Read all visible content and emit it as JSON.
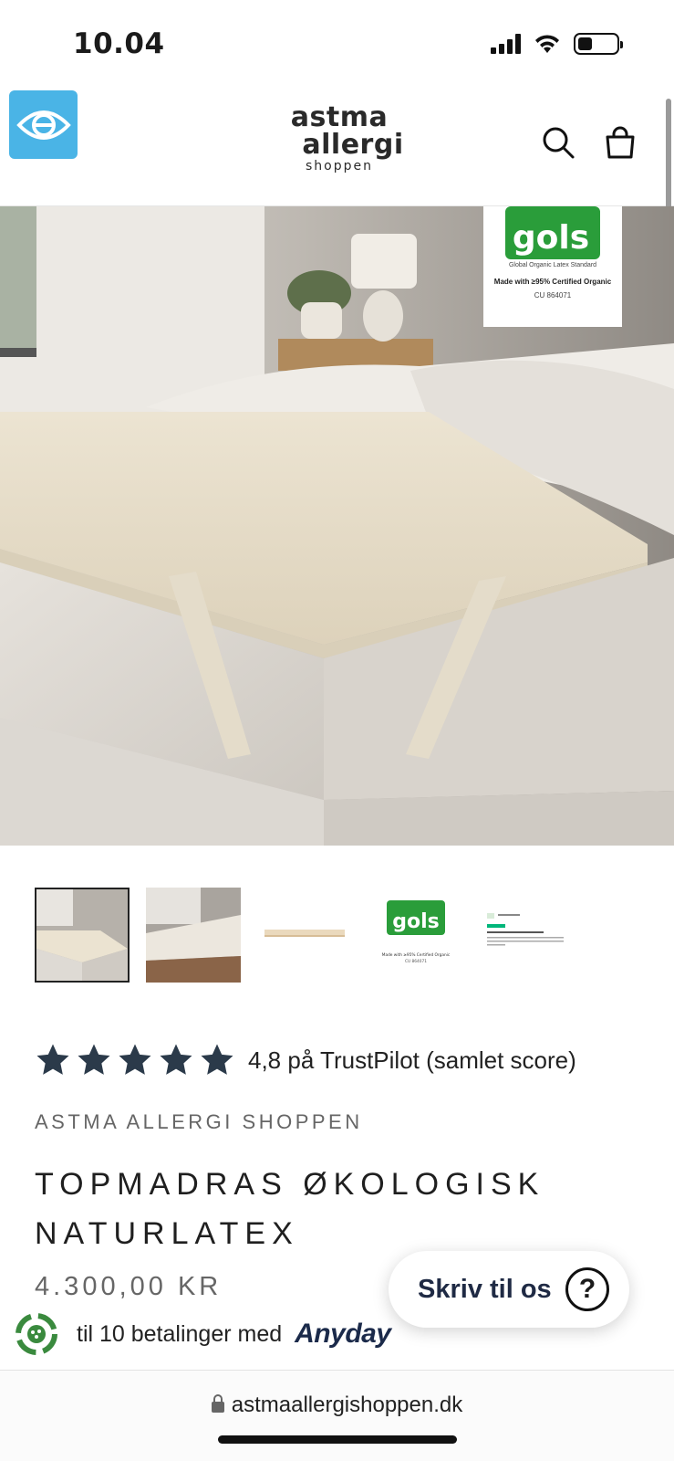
{
  "status": {
    "time": "10.04"
  },
  "header": {
    "logo": {
      "line1": "astma",
      "line2": "allergi",
      "line3": "shoppen"
    },
    "icons": [
      "accessibility-eye-icon",
      "search-icon",
      "shopping-bag-icon"
    ],
    "accent": "#4ab4e6"
  },
  "hero": {
    "badge": {
      "top": "Global Organic Latex Standard",
      "logo": "gols",
      "made": "Made with ≥95% Certified Organic",
      "cert": "CU 864071"
    }
  },
  "thumbnails": {
    "gols": {
      "logo": "gols",
      "top": "Global Organic Latex Standard",
      "made": "Made with ≥95% Certified Organic",
      "cert": "CU 864071"
    }
  },
  "product": {
    "stars": 5,
    "rating_text": "4,8 på TrustPilot (samlet score)",
    "brand": "ASTMA ALLERGI SHOPPEN",
    "title": "TOPMADRAS ØKOLOGISK NATURLATEX",
    "price": "4.300,00 KR",
    "anyday_text": "til 10 betalinger med",
    "anyday_brand": "Anyday"
  },
  "chat": {
    "label": "Skriv til os",
    "icon": "?"
  },
  "browser": {
    "url": "astmaallergishoppen.dk"
  },
  "colors": {
    "gols_green": "#2a9d3a",
    "star": "#2b3a4a",
    "anyday_green": "#3a8a3e"
  }
}
